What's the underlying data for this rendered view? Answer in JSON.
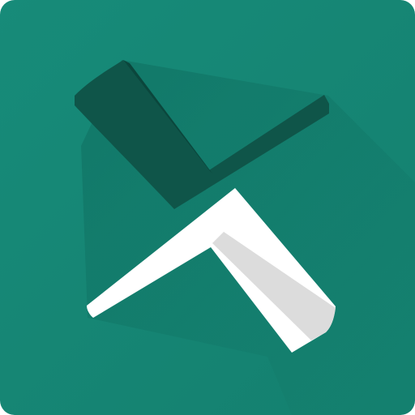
{
  "app_icon": {
    "icon_name": "crossed-chevrons-logo-icon",
    "colors": {
      "background": "#14806F",
      "background_light": "#178B79",
      "dark_chevron": "#0F5549",
      "dark_chevron_edge": "#0B463C",
      "light_chevron": "#FFFFFF",
      "light_chevron_shade": "#DCDCDC",
      "long_shadow": "#0E6B5D"
    }
  }
}
